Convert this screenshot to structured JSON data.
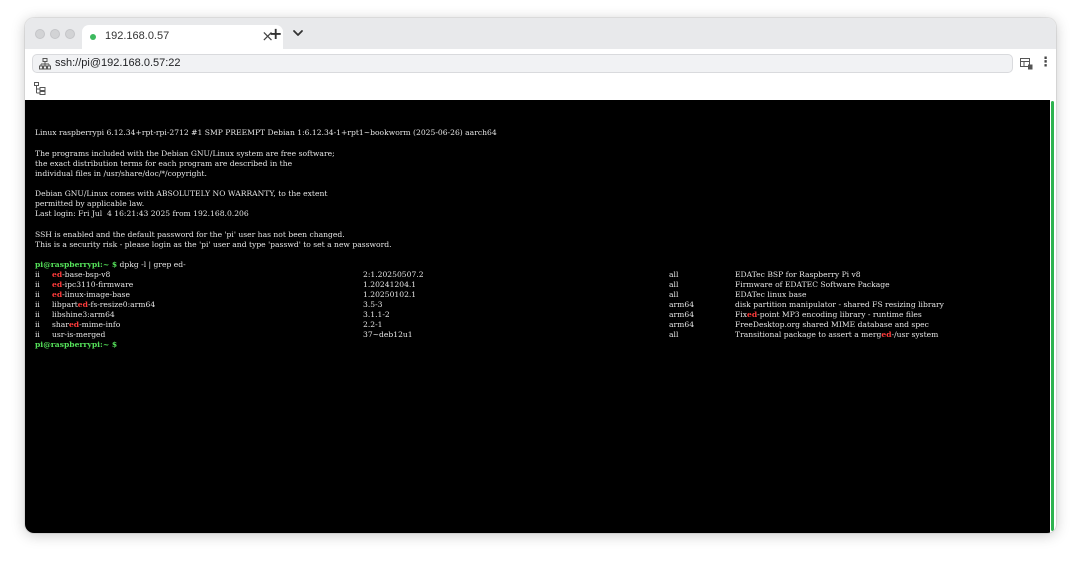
{
  "tab": {
    "title": "192.168.0.57",
    "close": "×",
    "new_tab": "+"
  },
  "address": {
    "url": "ssh://pi@192.168.0.57:22"
  },
  "terminal": {
    "banner": "Linux raspberrypi 6.12.34+rpt-rpi-2712 #1 SMP PREEMPT Debian 1:6.12.34-1+rpt1~bookworm (2025-06-26) aarch64",
    "free_software": [
      "The programs included with the Debian GNU/Linux system are free software;",
      "the exact distribution terms for each program are described in the",
      "individual files in /usr/share/doc/*/copyright."
    ],
    "warranty": [
      "Debian GNU/Linux comes with ABSOLUTELY NO WARRANTY, to the extent",
      "permitted by applicable law.",
      "Last login: Fri Jul  4 16:21:43 2025 from 192.168.0.206"
    ],
    "ssh_warning": [
      "SSH is enabled and the default password for the 'pi' user has not been changed.",
      "This is a security risk - please login as the 'pi' user and type 'passwd' to set a new password."
    ],
    "prompt_user": "pi@raspberrypi",
    "prompt_path": ":~ $",
    "command": " dpkg -l | grep ed-",
    "packages": [
      {
        "status": "ii",
        "pre": "",
        "hl": "ed",
        "post": "-base-bsp-v8",
        "version": "2:1.20250507.2",
        "arch": "all",
        "desc_pre": "EDATec BSP for Raspberry Pi v8",
        "desc_hl": "",
        "desc_post": ""
      },
      {
        "status": "ii",
        "pre": "",
        "hl": "ed",
        "post": "-ipc3110-firmware",
        "version": "1.20241204.1",
        "arch": "all",
        "desc_pre": "Firmware of EDATEC Software Package",
        "desc_hl": "",
        "desc_post": ""
      },
      {
        "status": "ii",
        "pre": "",
        "hl": "ed",
        "post": "-linux-image-base",
        "version": "1.20250102.1",
        "arch": "all",
        "desc_pre": "EDATec linux base",
        "desc_hl": "",
        "desc_post": ""
      },
      {
        "status": "ii",
        "pre": "libpart",
        "hl": "ed",
        "post": "-fs-resize0:arm64",
        "version": "3.5-3",
        "arch": "arm64",
        "desc_pre": "disk partition manipulator - shared FS resizing library",
        "desc_hl": "",
        "desc_post": ""
      },
      {
        "status": "ii",
        "pre": "libshine3:arm64",
        "hl": "",
        "post": "",
        "version": "3.1.1-2",
        "arch": "arm64",
        "desc_pre": "Fix",
        "desc_hl": "ed",
        "desc_post": "-point MP3 encoding library - runtime files"
      },
      {
        "status": "ii",
        "pre": "shar",
        "hl": "ed",
        "post": "-mime-info",
        "version": "2.2-1",
        "arch": "arm64",
        "desc_pre": "FreeDesktop.org shared MIME database and spec",
        "desc_hl": "",
        "desc_post": ""
      },
      {
        "status": "ii",
        "pre": "usr-is-merged",
        "hl": "",
        "post": "",
        "version": "37~deb12u1",
        "arch": "all",
        "desc_pre": "Transitional package to assert a merg",
        "desc_hl": "ed",
        "desc_post": "-/usr system"
      }
    ],
    "final_prompt_path": ":~ $"
  },
  "colors": {
    "prompt": "#55e25a",
    "highlight": "#ff3b3b",
    "terminal_bg": "#000000",
    "scroll_thumb": "#2eb34f"
  },
  "icons": [
    "network-icon",
    "extension-icon",
    "more-menu-icon",
    "file-tree-icon",
    "chevron-down-icon"
  ]
}
